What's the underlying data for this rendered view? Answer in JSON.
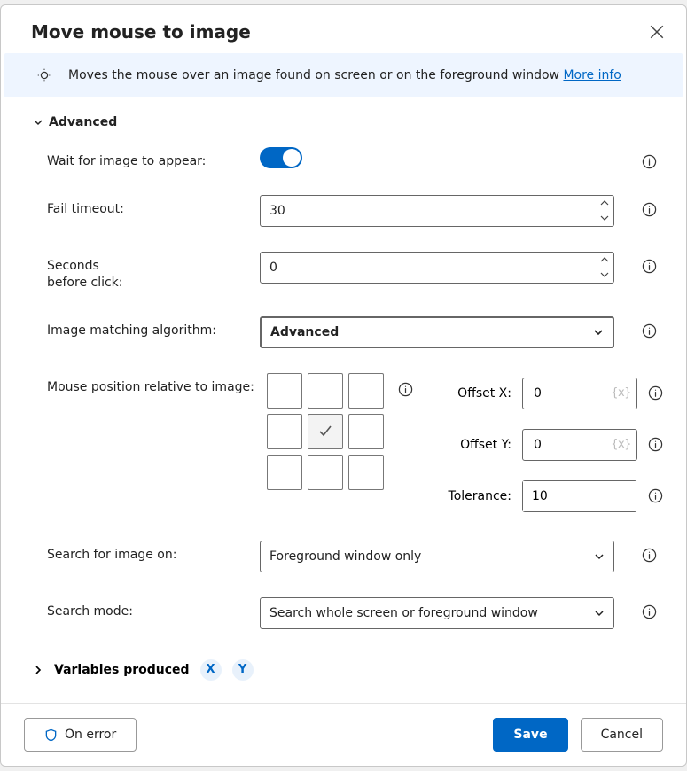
{
  "dialog": {
    "title": "Move mouse to image"
  },
  "banner": {
    "text": "Moves the mouse over an image found on screen or on the foreground window",
    "more": "More info"
  },
  "sections": {
    "advanced": "Advanced",
    "variables": "Variables produced"
  },
  "labels": {
    "wait": "Wait for image to appear:",
    "fail_timeout": "Fail timeout:",
    "seconds_before": "Seconds\nbefore click:",
    "algorithm": "Image matching algorithm:",
    "mouse_pos": "Mouse position relative to image:",
    "offset_x": "Offset X:",
    "offset_y": "Offset Y:",
    "tolerance": "Tolerance:",
    "search_on": "Search for image on:",
    "search_mode": "Search mode:"
  },
  "values": {
    "wait_toggle": true,
    "fail_timeout": "30",
    "seconds_before": "0",
    "algorithm": "Advanced",
    "offset_x": "0",
    "offset_y": "0",
    "tolerance": "10",
    "search_on": "Foreground window only",
    "search_mode": "Search whole screen or foreground window",
    "position_selected": 4
  },
  "fx_placeholder": "{x}",
  "variables": {
    "x": "X",
    "y": "Y"
  },
  "footer": {
    "on_error": "On error",
    "save": "Save",
    "cancel": "Cancel"
  }
}
